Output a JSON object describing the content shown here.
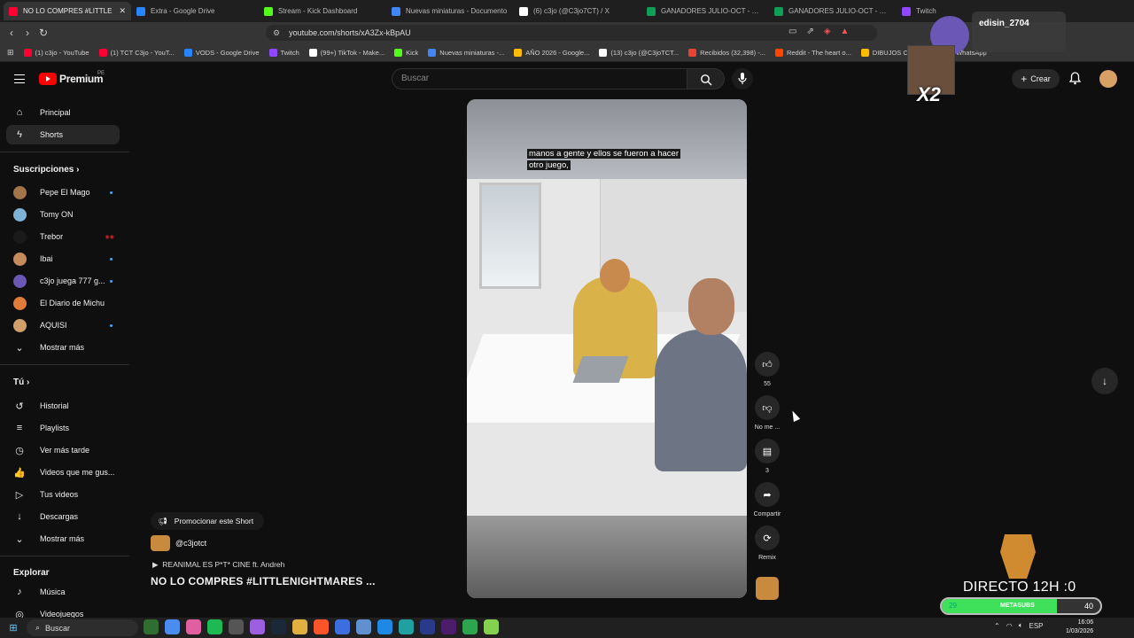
{
  "browser": {
    "tabs": [
      {
        "title": "NO LO COMPRES #LITTLE",
        "color": "#ff0033",
        "active": true
      },
      {
        "title": "Extra - Google Drive",
        "color": "#2684fc"
      },
      {
        "title": "Stream - Kick Dashboard",
        "color": "#53fc18"
      },
      {
        "title": "Nuevas miniaturas - Documento",
        "color": "#4285f4"
      },
      {
        "title": "(6) c3jo (@C3jo7CT) / X",
        "color": "#ffffff"
      },
      {
        "title": "GANADORES JULIO-OCT - Hojas",
        "color": "#0f9d58"
      },
      {
        "title": "GANADORES JULIO-OCT - Hojas",
        "color": "#0f9d58"
      },
      {
        "title": "Twitch",
        "color": "#9146ff"
      }
    ],
    "tab_close": "✕",
    "url": "youtube.com/shorts/xA3Zx-kBpAU",
    "bookmarks": [
      {
        "label": "(1) c3jo - YouTube",
        "color": "#ff0033"
      },
      {
        "label": "(1) TCT C3jo - YouT...",
        "color": "#ff0033"
      },
      {
        "label": "VODS - Google Drive",
        "color": "#2684fc"
      },
      {
        "label": "Twitch",
        "color": "#9146ff"
      },
      {
        "label": "(99+) TikTok - Make...",
        "color": "#ffffff"
      },
      {
        "label": "Kick",
        "color": "#53fc18"
      },
      {
        "label": "Nuevas miniaturas -...",
        "color": "#4285f4"
      },
      {
        "label": "AÑO 2026 - Google...",
        "color": "#fbbc04"
      },
      {
        "label": "(13) c3jo (@C3joTCT...",
        "color": "#ffffff"
      },
      {
        "label": "Recibidos (32,398) -...",
        "color": "#ea4335"
      },
      {
        "label": "Reddit - The heart o...",
        "color": "#ff4500"
      },
      {
        "label": "DIBUJOS CE...",
        "color": "#fbbc04"
      },
      {
        "label": "(118) WhatsApp",
        "color": "#25d366"
      }
    ]
  },
  "youtube": {
    "logo": "Premium",
    "country": "PE",
    "search_placeholder": "Buscar",
    "create_label": "Crear",
    "sidebar": {
      "main": [
        {
          "label": "Principal",
          "icon": "home-icon",
          "glyph": "⌂",
          "active": false
        },
        {
          "label": "Shorts",
          "icon": "shorts-icon",
          "glyph": "ϟ",
          "active": true
        }
      ],
      "subs_header": "Suscripciones",
      "subs": [
        {
          "label": "Pepe El Mago",
          "color": "#a2744a",
          "badge": "dot"
        },
        {
          "label": "Tomy ON",
          "color": "#7fb3d5",
          "badge": ""
        },
        {
          "label": "Trebor",
          "color": "#1a1a1a",
          "badge": "live"
        },
        {
          "label": "Ibai",
          "color": "#c58b5c",
          "badge": "dot"
        },
        {
          "label": "c3jo juega 777 g...",
          "color": "#6b57b5",
          "badge": "dot"
        },
        {
          "label": "El Diario de Michu",
          "color": "#e07b39",
          "badge": ""
        },
        {
          "label": "AQUISI",
          "color": "#d1a06a",
          "badge": "dot"
        }
      ],
      "subs_more": "Mostrar más",
      "you_header": "Tú",
      "you": [
        {
          "label": "Historial",
          "glyph": "↺",
          "icon": "history-icon"
        },
        {
          "label": "Playlists",
          "glyph": "≡",
          "icon": "playlists-icon"
        },
        {
          "label": "Ver más tarde",
          "glyph": "◷",
          "icon": "watch-later-icon"
        },
        {
          "label": "Videos que me gus...",
          "glyph": "👍",
          "icon": "liked-icon"
        },
        {
          "label": "Tus videos",
          "glyph": "▷",
          "icon": "your-videos-icon"
        },
        {
          "label": "Descargas",
          "glyph": "↓",
          "icon": "downloads-icon"
        },
        {
          "label": "Mostrar más",
          "glyph": "⌄",
          "icon": "chevron-down-icon"
        }
      ],
      "explore_header": "Explorar",
      "explore": [
        {
          "label": "Música",
          "glyph": "♪",
          "icon": "music-icon"
        },
        {
          "label": "Videojuegos",
          "glyph": "◎",
          "icon": "gaming-icon"
        }
      ]
    },
    "short": {
      "caption_line1": "manos a gente y ellos se fueron a hacer",
      "caption_line2": "otro juego,",
      "likes": "55",
      "dislike_label": "No me ...",
      "comments": "3",
      "share_label": "Compartir",
      "remix_label": "Remix",
      "promote": "Promocionar este Short",
      "channel": "@c3jotct",
      "song": "REANIMAL ES P*T* CINE ft. Andreh",
      "title": "NO LO COMPRES #LITTLENIGHTMARES ..."
    }
  },
  "overlay": {
    "username": "edisin_2704",
    "multiplier": "X2",
    "directo": "DIRECTO 12H :0",
    "bar_current": "29",
    "bar_label": "METASUBS",
    "bar_target": "40",
    "bar_fraction": 0.725
  },
  "taskbar": {
    "search": "Buscar",
    "apps": [
      "#2f6d31",
      "#4a8cf0",
      "#e05fa0",
      "#1db954",
      "#555",
      "#9b5fe0",
      "#1b2838",
      "#e0b040",
      "#fb542b",
      "#3c6ee0",
      "#6090d0",
      "#1e88e5",
      "#20a0a0",
      "#2a3a8a",
      "#4b1d6b",
      "#2ea44f",
      "#86d04f"
    ],
    "lang": "ESP",
    "time": "16:06",
    "date": "1/03/2026"
  }
}
